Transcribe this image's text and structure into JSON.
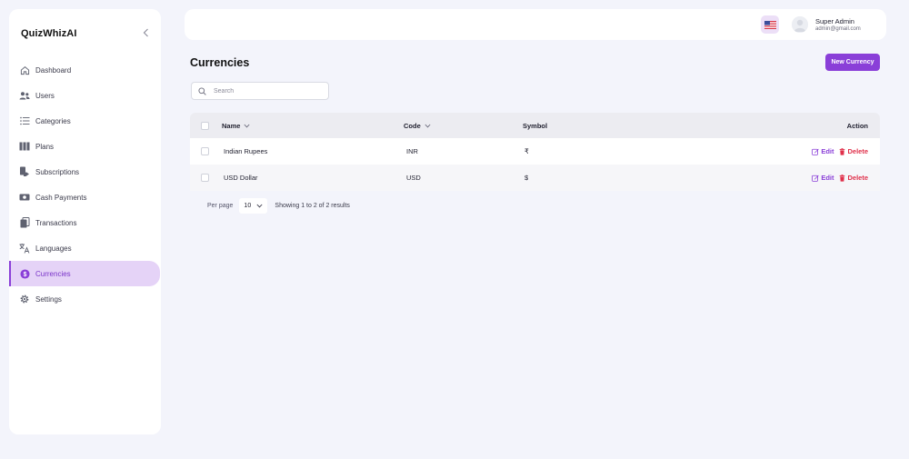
{
  "brand": "QuizWhizAI",
  "sidebar": {
    "items": [
      {
        "label": "Dashboard",
        "icon": "home-icon"
      },
      {
        "label": "Users",
        "icon": "users-icon"
      },
      {
        "label": "Categories",
        "icon": "list-icon"
      },
      {
        "label": "Plans",
        "icon": "columns-icon"
      },
      {
        "label": "Subscriptions",
        "icon": "subscriptions-icon"
      },
      {
        "label": "Cash Payments",
        "icon": "cash-icon"
      },
      {
        "label": "Transactions",
        "icon": "transactions-icon"
      },
      {
        "label": "Languages",
        "icon": "translate-icon"
      },
      {
        "label": "Currencies",
        "icon": "currency-icon",
        "active": true
      },
      {
        "label": "Settings",
        "icon": "gear-icon"
      }
    ]
  },
  "header": {
    "user_name": "Super Admin",
    "user_email": "admin@gmail.com",
    "flag": "us-flag-icon"
  },
  "main": {
    "title": "Currencies",
    "new_button": "New Currency",
    "search_placeholder": "Search"
  },
  "table": {
    "columns": {
      "name": "Name",
      "code": "Code",
      "symbol": "Symbol",
      "action": "Action"
    },
    "rows": [
      {
        "name": "Indian Rupees",
        "code": "INR",
        "symbol": "₹"
      },
      {
        "name": "USD Dollar",
        "code": "USD",
        "symbol": "$"
      }
    ],
    "edit_label": "Edit",
    "delete_label": "Delete"
  },
  "pagination": {
    "per_page_label": "Per page",
    "per_page_value": "10",
    "showing": "Showing 1 to 2 of 2 results"
  },
  "colors": {
    "accent": "#8a3fd8",
    "danger": "#e0314b",
    "active_bg": "#e5d3f7",
    "page_bg": "#f3f4fb"
  }
}
